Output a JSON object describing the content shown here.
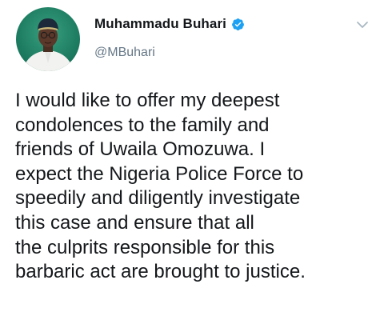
{
  "author": {
    "name": "Muhammadu Buhari",
    "handle": "@MBuhari",
    "avatar_icon": "profile-photo",
    "verified_icon": "verified-badge-icon"
  },
  "menu_icon": "chevron-down-icon",
  "tweet": {
    "lines": [
      "I would like to offer my deepest",
      "condolences to the family and",
      "friends of Uwaila Omozuwa. I",
      "expect the Nigeria Police Force to",
      "speedily and diligently investigate",
      "this case and ensure that all",
      "the culprits responsible for this",
      "barbaric act are brought to justice."
    ]
  },
  "colors": {
    "text": "#14171a",
    "secondary": "#657786",
    "verified": "#1da1f2",
    "avatar_bg": "#1e8a6e"
  }
}
